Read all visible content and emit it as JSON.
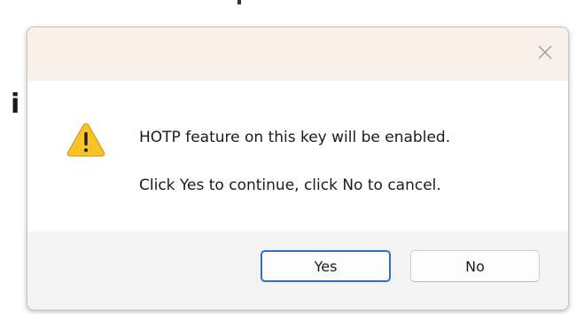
{
  "backdrop": {
    "glyph": "i"
  },
  "dialog": {
    "title": "",
    "close_icon": "close-icon",
    "warning_icon": "warning-icon",
    "message_line1": "HOTP feature on this key will be enabled.",
    "message_line2": "Click Yes to continue, click No to cancel.",
    "buttons": {
      "yes_label": "Yes",
      "no_label": "No"
    }
  },
  "colors": {
    "titlebar": "#f9f0ea",
    "footer": "#f3f3f3",
    "focus_border": "#2f6fc4",
    "warning_fill": "#f7c325"
  }
}
